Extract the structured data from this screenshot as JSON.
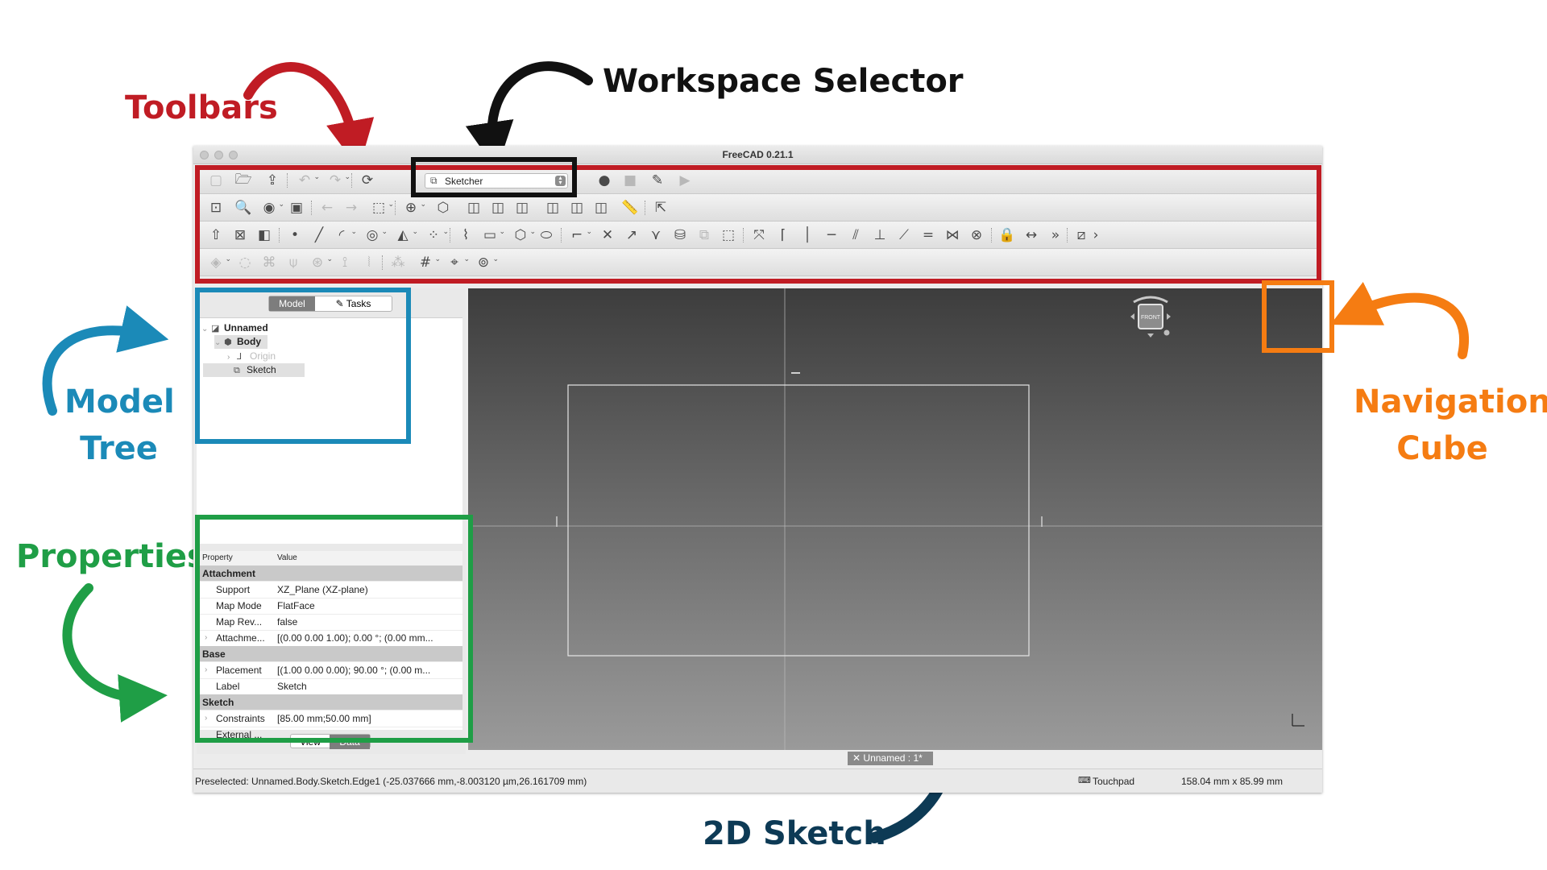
{
  "annotations": {
    "toolbars": "Toolbars",
    "workspace_selector": "Workspace Selector",
    "model_tree_line1": "Model",
    "model_tree_line2": "Tree",
    "properties": "Properties",
    "navigation_line1": "Navigation",
    "navigation_line2": "Cube",
    "sketch_2d": "2D Sketch",
    "colors": {
      "toolbars": "#c01c24",
      "workspace": "#111111",
      "model_tree": "#1b8ab8",
      "properties": "#1f9e46",
      "navigation": "#f57c12",
      "sketch": "#0d3a55"
    }
  },
  "window": {
    "title": "FreeCAD 0.21.1"
  },
  "workbench_selector": {
    "value": "Sketcher",
    "icon": "sketcher-workbench-icon"
  },
  "combo_view": {
    "tabs": {
      "model": "Model",
      "tasks": "Tasks"
    },
    "tree": [
      {
        "label": "Unnamed",
        "icon": "document-icon"
      },
      {
        "label": "Body",
        "icon": "body-icon"
      },
      {
        "label": "Origin",
        "icon": "origin-icon"
      },
      {
        "label": "Sketch",
        "icon": "sketch-icon"
      }
    ],
    "properties": {
      "col_property": "Property",
      "col_value": "Value",
      "groups": {
        "attachment": "Attachment",
        "base": "Base",
        "sketch": "Sketch"
      },
      "rows": [
        {
          "key": "Support",
          "value": "XZ_Plane (XZ-plane)"
        },
        {
          "key": "Map Mode",
          "value": "FlatFace"
        },
        {
          "key": "Map Rev...",
          "value": "false"
        },
        {
          "key": "Attachme...",
          "value": "[(0.00 0.00 1.00); 0.00 °; (0.00 mm..."
        },
        {
          "key": "Placement",
          "value": "[(1.00 0.00 0.00); 90.00 °; (0.00 m..."
        },
        {
          "key": "Label",
          "value": "Sketch"
        },
        {
          "key": "Constraints",
          "value": "[85.00 mm;50.00 mm]"
        },
        {
          "key": "External ...",
          "value": ""
        }
      ]
    },
    "view_tabs": {
      "view": "View",
      "data": "Data"
    }
  },
  "navigation_cube": {
    "face": "FRONT"
  },
  "document_tab": {
    "close": "✕",
    "label": "Unnamed : 1*"
  },
  "status_bar": {
    "message": "Preselected: Unnamed.Body.Sketch.Edge1 (-25.037666 mm,-8.003120 µm,26.161709 mm)",
    "navigation_style": "Touchpad",
    "dimensions": "158.04 mm x 85.99 mm"
  }
}
